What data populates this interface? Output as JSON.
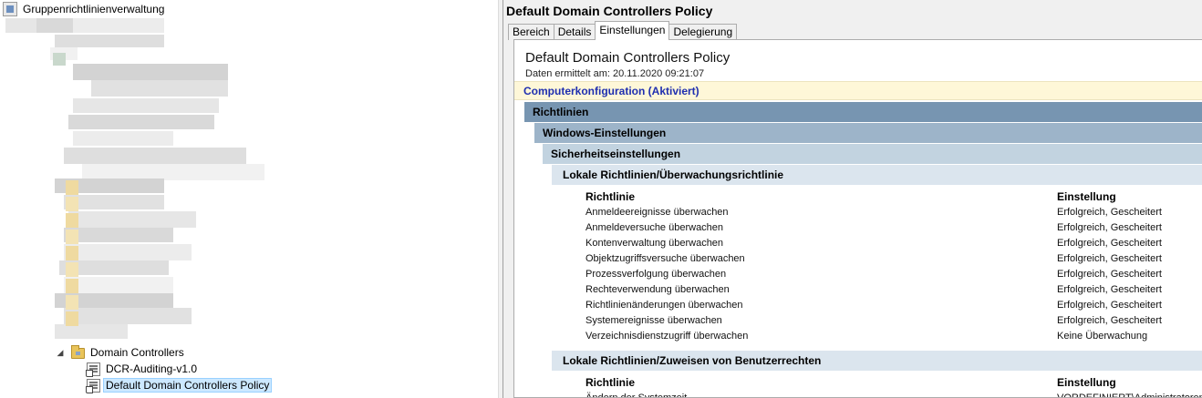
{
  "tree": {
    "root_label": "Gruppenrichtlinienverwaltung",
    "domain_controllers_label": "Domain Controllers",
    "children": [
      {
        "label": "DCR-Auditing-v1.0",
        "selected": false
      },
      {
        "label": "Default Domain Controllers Policy",
        "selected": true
      }
    ]
  },
  "details": {
    "policy_title": "Default Domain Controllers Policy",
    "tabs": [
      {
        "label": "Bereich",
        "active": false
      },
      {
        "label": "Details",
        "active": false
      },
      {
        "label": "Einstellungen",
        "active": true
      },
      {
        "label": "Delegierung",
        "active": false
      }
    ],
    "report": {
      "title": "Default Domain Controllers Policy",
      "date_line": "Daten ermittelt am: 20.11.2020 09:21:07",
      "computer_config": "Computerkonfiguration (Aktiviert)",
      "sections": {
        "richtlinien": "Richtlinien",
        "windows_einstellungen": "Windows-Einstellungen",
        "sicherheitseinstellungen": "Sicherheitseinstellungen",
        "audit_policy": "Lokale Richtlinien/Überwachungsrichtlinie",
        "user_rights": "Lokale Richtlinien/Zuweisen von Benutzerrechten"
      },
      "columns": {
        "policy": "Richtlinie",
        "setting": "Einstellung"
      },
      "audit_rows": [
        {
          "policy": "Anmeldeereignisse überwachen",
          "setting": "Erfolgreich, Gescheitert"
        },
        {
          "policy": "Anmeldeversuche überwachen",
          "setting": "Erfolgreich, Gescheitert"
        },
        {
          "policy": "Kontenverwaltung überwachen",
          "setting": "Erfolgreich, Gescheitert"
        },
        {
          "policy": "Objektzugriffsversuche überwachen",
          "setting": "Erfolgreich, Gescheitert"
        },
        {
          "policy": "Prozessverfolgung überwachen",
          "setting": "Erfolgreich, Gescheitert"
        },
        {
          "policy": "Rechteverwendung überwachen",
          "setting": "Erfolgreich, Gescheitert"
        },
        {
          "policy": "Richtlinienänderungen überwachen",
          "setting": "Erfolgreich, Gescheitert"
        },
        {
          "policy": "Systemereignisse überwachen",
          "setting": "Erfolgreich, Gescheitert"
        },
        {
          "policy": "Verzeichnisdienstzugriff überwachen",
          "setting": "Keine Überwachung"
        }
      ],
      "user_rights_rows": [
        {
          "policy": "Ändern der Systemzeit",
          "setting": "VORDEFINIERT\\Administratoren"
        }
      ]
    }
  }
}
